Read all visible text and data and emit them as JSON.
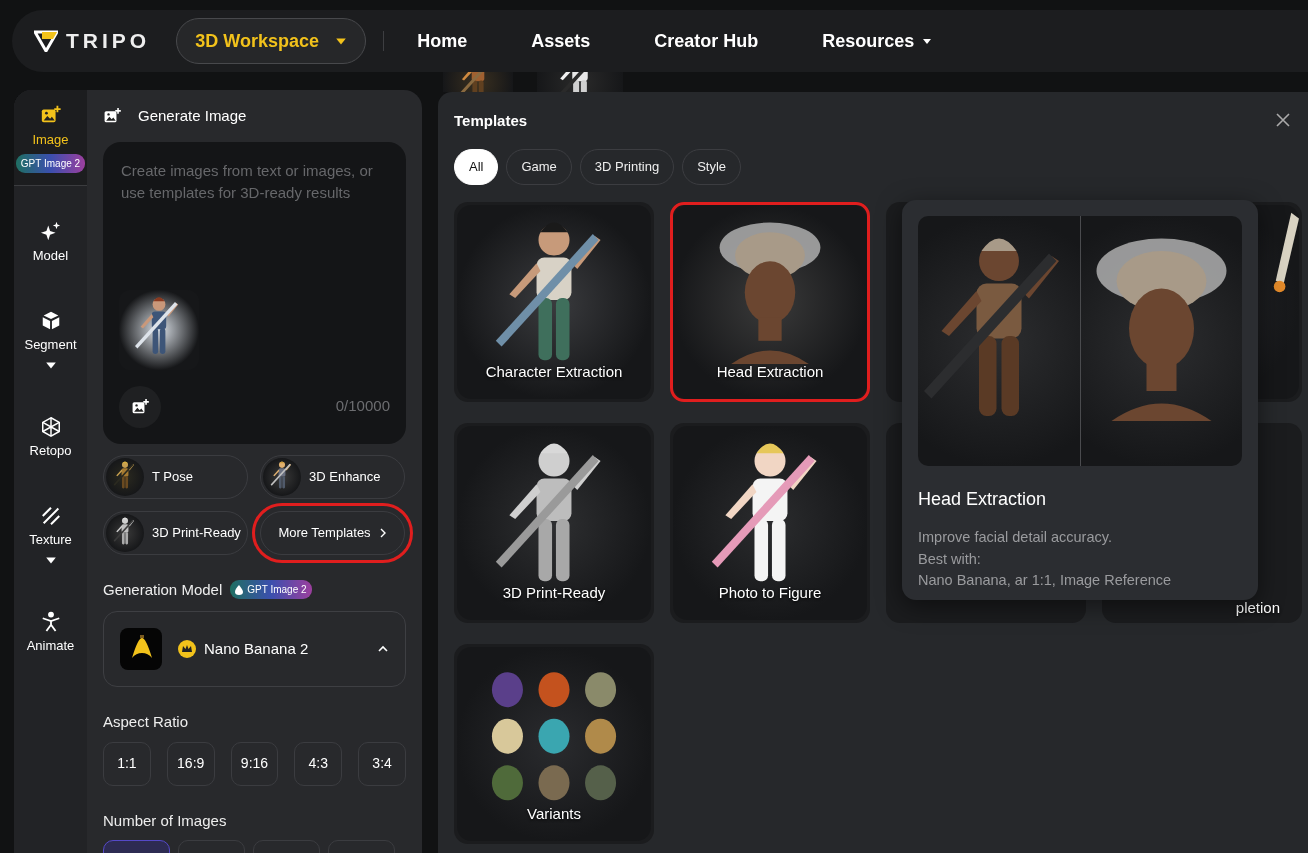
{
  "brand": {
    "name": "TRIPO"
  },
  "nav": {
    "workspace": "3D Workspace",
    "links": [
      {
        "label": "Home",
        "dropdown": false
      },
      {
        "label": "Assets",
        "dropdown": false
      },
      {
        "label": "Creator Hub",
        "dropdown": false
      },
      {
        "label": "Resources",
        "dropdown": true
      }
    ]
  },
  "rail": [
    {
      "label": "Image",
      "selected": true,
      "badge": "GPT Image 2",
      "dropdown": false
    },
    {
      "label": "Model",
      "selected": false,
      "dropdown": false
    },
    {
      "label": "Segment",
      "selected": false,
      "dropdown": true
    },
    {
      "label": "Retopo",
      "selected": false,
      "dropdown": false
    },
    {
      "label": "Texture",
      "selected": false,
      "dropdown": true
    },
    {
      "label": "Animate",
      "selected": false,
      "dropdown": false
    }
  ],
  "panel": {
    "title": "Generate Image",
    "prompt": {
      "placeholder": "Create images from text or images, or use templates for 3D-ready results",
      "counter": "0/10000"
    },
    "quick_templates": [
      {
        "label": "T Pose",
        "kind": "thumb",
        "highlighted": false
      },
      {
        "label": "3D Enhance",
        "kind": "thumb",
        "highlighted": false
      },
      {
        "label": "3D Print-Ready",
        "kind": "thumb",
        "highlighted": false
      },
      {
        "label": "More Templates",
        "kind": "more",
        "highlighted": true
      }
    ],
    "model_section": {
      "label": "Generation Model",
      "badge": "GPT Image 2",
      "model": "Nano Banana 2",
      "expanded": true
    },
    "aspect_ratio": {
      "label": "Aspect Ratio",
      "options": [
        {
          "label": "1:1",
          "selected": false
        },
        {
          "label": "16:9",
          "selected": false
        },
        {
          "label": "9:16",
          "selected": false
        },
        {
          "label": "4:3",
          "selected": false
        },
        {
          "label": "3:4",
          "selected": false
        }
      ]
    },
    "image_count": {
      "label": "Number of Images",
      "options": [
        {
          "selected": true
        },
        {
          "selected": false
        },
        {
          "selected": false
        },
        {
          "selected": false
        }
      ]
    }
  },
  "templates": {
    "title": "Templates",
    "filters": [
      {
        "label": "All",
        "selected": true
      },
      {
        "label": "Game",
        "selected": false
      },
      {
        "label": "3D Printing",
        "selected": false
      },
      {
        "label": "Style",
        "selected": false
      }
    ],
    "cards": [
      {
        "kind": "template",
        "label": "Character Extraction",
        "highlighted": false
      },
      {
        "kind": "template",
        "label": "Head Extraction",
        "highlighted": true
      },
      {
        "kind": "template",
        "highlighted": false
      },
      {
        "kind": "template",
        "highlighted": false
      },
      {
        "kind": "template",
        "label": "3D Print-Ready",
        "highlighted": false
      },
      {
        "kind": "template",
        "label": "Photo to Figure",
        "highlighted": false
      },
      {
        "kind": "template",
        "highlighted": false
      },
      {
        "kind": "covered",
        "label": "pletion",
        "highlighted": false
      },
      {
        "kind": "template",
        "label": "Variants",
        "highlighted": false
      }
    ],
    "popover": {
      "title": "Head Extraction",
      "description": "Improve facial detail accuracy.\nBest with:\nNano Banana, ar 1:1, Image Reference"
    }
  }
}
